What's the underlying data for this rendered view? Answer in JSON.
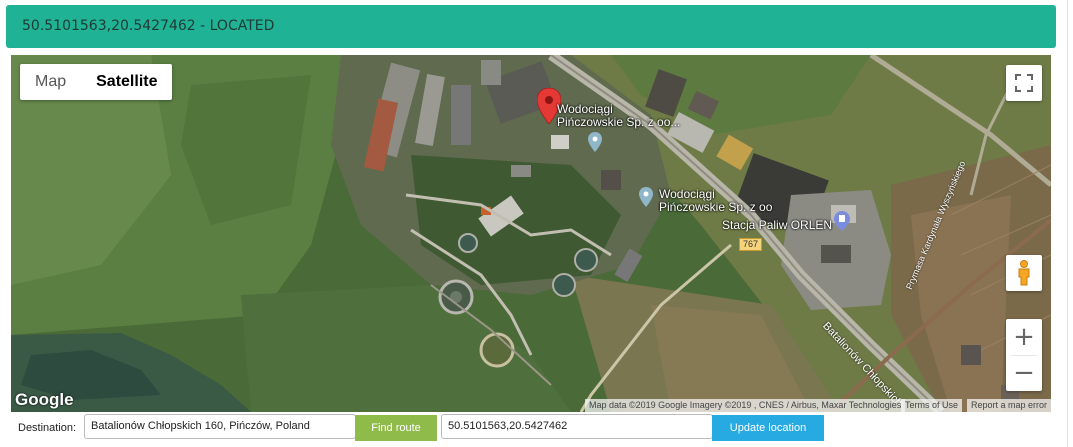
{
  "header": {
    "title": "50.5101563,20.5427462 - LOCATED"
  },
  "map": {
    "type_control": {
      "map_label": "Map",
      "satellite_label": "Satellite",
      "selected": "Satellite"
    },
    "pois": [
      {
        "line1": "Wodociągi",
        "line2": "Pińczowskie Sp. z oo..."
      },
      {
        "line1": "Wodociągi",
        "line2": "Pińczowskie Sp. z oo"
      },
      {
        "line1": "Stacja Paliw ORLEN",
        "line2": ""
      }
    ],
    "road_shield": "767",
    "street_labels": [
      "Batalionów Chłopskich",
      "Prymasa Kardynała Wyszyńskiego"
    ],
    "logo": "Google",
    "attribution": "Map data ©2019 Google Imagery ©2019 , CNES / Airbus, Maxar Technologies",
    "terms": "Terms of Use",
    "report": "Report a map error",
    "zoom_in": "+",
    "zoom_out": "−"
  },
  "form": {
    "destination_label": "Destination:",
    "destination_value": "Batalionów Chłopskich 160, Pińczów, Poland",
    "find_route_label": "Find route",
    "coordinates_value": "50.5101563,20.5427462",
    "update_label": "Update location"
  },
  "colors": {
    "header": "#1fb295",
    "find_button": "#8fbb4a",
    "update_button": "#27a9e1",
    "marker": "#e53935"
  }
}
